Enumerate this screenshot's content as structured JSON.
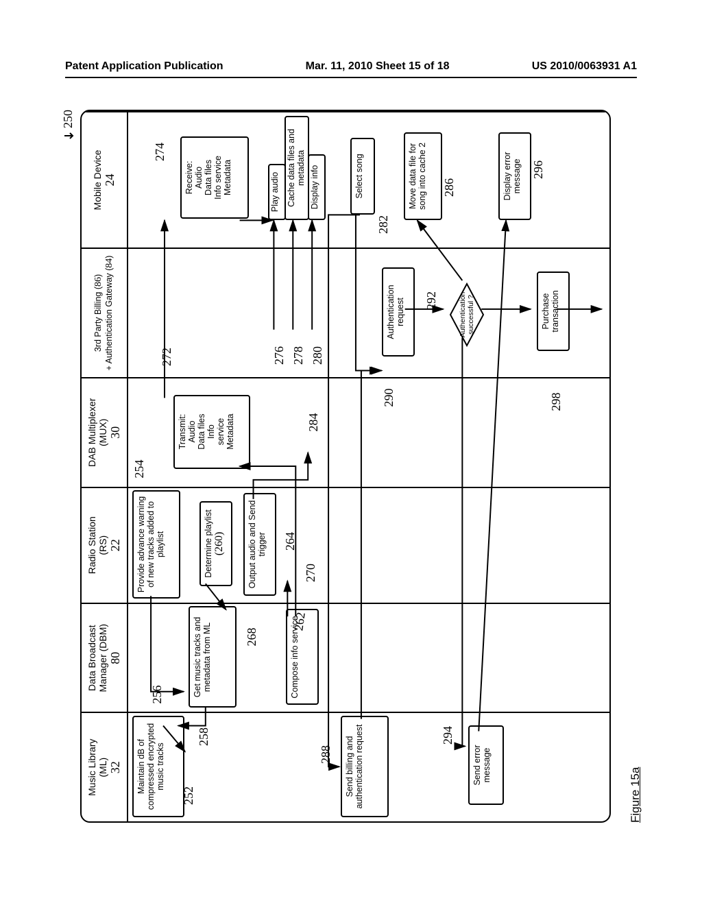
{
  "header": {
    "left": "Patent Application Publication",
    "center": "Mar. 11, 2010  Sheet 15 of 18",
    "right": "US 2010/0063931 A1"
  },
  "figure_label": "Figure 15a",
  "top_ref": "250",
  "lanes": {
    "ml": {
      "title": "Music Library\n(ML)",
      "num": "32"
    },
    "dbm": {
      "title": "Data Broadcast\nManager (DBM)",
      "num": "80"
    },
    "rs": {
      "title": "Radio Station\n(RS)",
      "num": "22"
    },
    "mux": {
      "title": "DAB Multiplexer\n(MUX)",
      "num": "30"
    },
    "bill": {
      "title_line1": "3rd Party Billing",
      "num1": "86",
      "title_line2": "+ Authentication Gateway",
      "num2": "84"
    },
    "md": {
      "title": "Mobile Device",
      "num": "24"
    }
  },
  "boxes": {
    "b252": "Maintain dB of compressed encrypted music tracks",
    "b258_get": "Get music tracks and metadata from ML",
    "b254": "Provide advance warning of new tracks added to playlist",
    "b260": "Determine playlist",
    "b262": "Compose info service",
    "b270": "Output audio and Send trigger",
    "b272_transmit": "Transmit:\nAudio\nData files\nInfo\nservice\nMetadata",
    "b274_receive": "Receive:\nAudio\nData files\nInfo service\nMetadata",
    "b276": "Play audio",
    "b278": "Cache data files and metadata",
    "b280": "Display info",
    "b282": "Select song",
    "b288": "Send billing and authentication request",
    "b290": "Authentication request",
    "b292": "Authentication successful ?",
    "b286": "Move data file for song into cache 2",
    "b294": "Send error message",
    "b296": "Display error message",
    "b298": "Purchase transaction"
  },
  "refs": {
    "r250": "250",
    "r252": "252",
    "r254": "254",
    "r256": "256",
    "r258": "258",
    "r260": "260",
    "r262": "262",
    "r264": "264",
    "r268": "268",
    "r270": "270",
    "r272": "272",
    "r274": "274",
    "r276": "276",
    "r278": "278",
    "r280": "280",
    "r282": "282",
    "r284": "284",
    "r286": "286",
    "r288": "288",
    "r290": "290",
    "r292": "292",
    "r294": "294",
    "r296": "296",
    "r298": "298"
  }
}
